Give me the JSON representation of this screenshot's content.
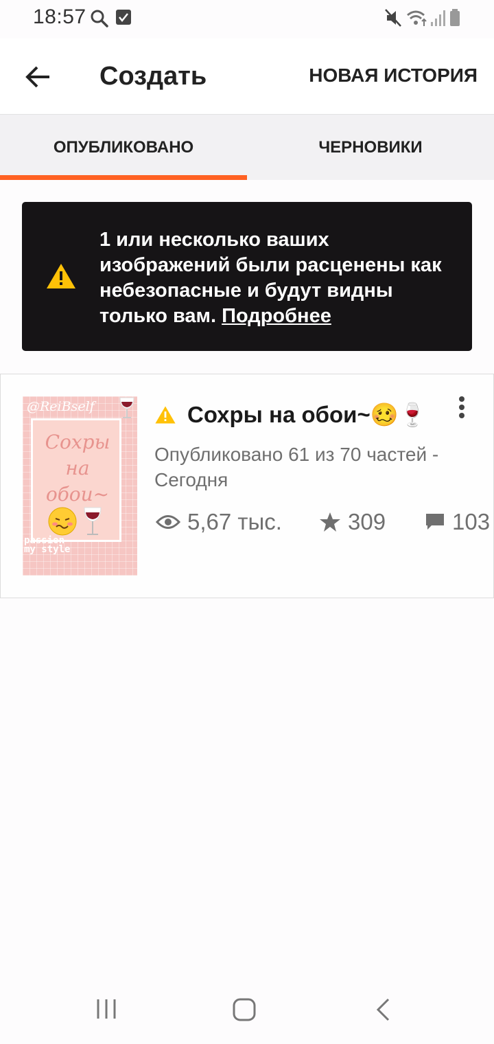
{
  "status_bar": {
    "time": "18:57",
    "icons": [
      "search-icon",
      "checkbox-icon",
      "mute-icon",
      "wifi-icon",
      "signal-icon",
      "battery-icon"
    ]
  },
  "header": {
    "back_icon": "arrow-left-icon",
    "title": "Создать",
    "new_story_label": "НОВАЯ ИСТОРИЯ"
  },
  "tabs": {
    "published_label": "ОПУБЛИКОВАНО",
    "drafts_label": "ЧЕРНОВИКИ",
    "active": "published",
    "accent_color": "#ff6122"
  },
  "warning": {
    "text": "1 или несколько ваших изображений были расценены как небезопасные и будут видны только вам.",
    "link": "Подробнее",
    "icon": "warning-icon"
  },
  "story": {
    "cover": {
      "handle": "@ReiBself",
      "title_line1": "Сохры",
      "title_line2": "на",
      "title_line3": "обои~",
      "style_line1": "passion",
      "style_line2": "my style"
    },
    "title": "Сохры на обои~🥴🍷",
    "meta": "Опубликовано 61 из 70 частей - Сегодня",
    "views": "5,67 тыс.",
    "votes": "309",
    "comments": "103",
    "menu_icon": "more-vert-icon"
  },
  "nav_bar": {
    "icons": [
      "recent-apps-icon",
      "home-icon",
      "back-nav-icon"
    ]
  }
}
